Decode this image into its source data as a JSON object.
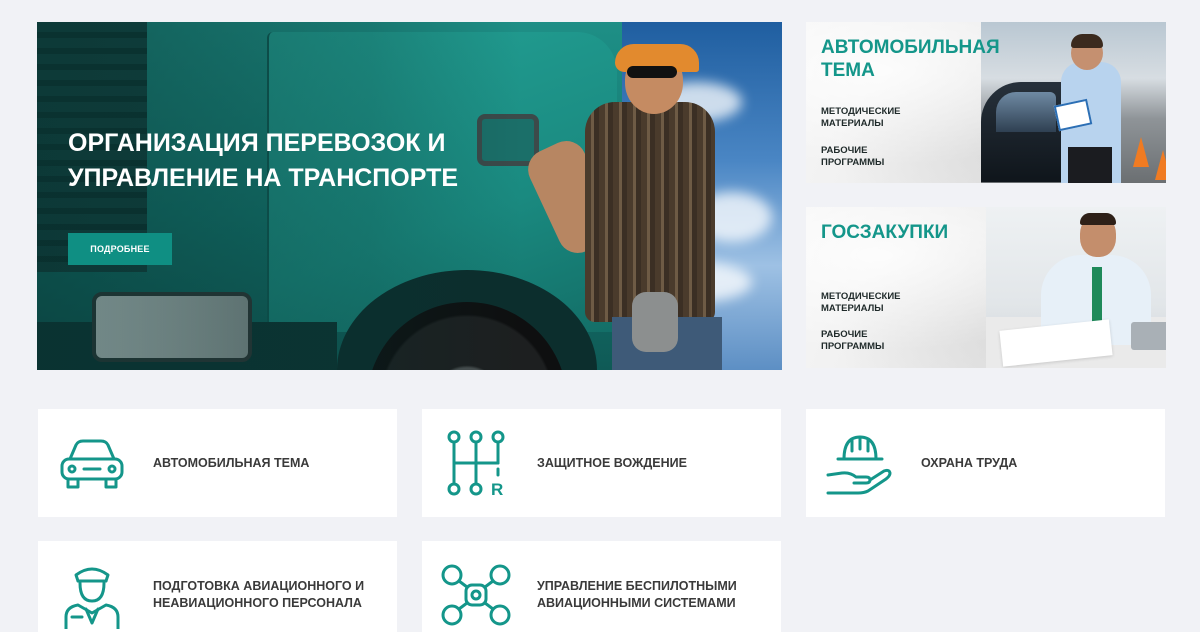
{
  "hero": {
    "title": "Организация перевозок и управление на транспорте",
    "button_label": "ПОДРОБНЕЕ"
  },
  "banners": [
    {
      "title": "Автомобильная тема",
      "links": [
        "Методические материалы",
        "Рабочие программы"
      ]
    },
    {
      "title": "Госзакупки",
      "links": [
        "Методические материалы",
        "Рабочие программы"
      ]
    }
  ],
  "categories": [
    {
      "label": "Автомобильная тема",
      "icon": "car-icon"
    },
    {
      "label": "Защитное вождение",
      "icon": "gearbox-icon"
    },
    {
      "label": "Охрана труда",
      "icon": "hardhat-hand-icon"
    },
    {
      "label": "Подготовка авиационного и неавиационного персонала",
      "icon": "pilot-icon"
    },
    {
      "label": "Управление беспилотными авиационными системами",
      "icon": "drone-icon"
    }
  ],
  "colors": {
    "accent": "#14968a",
    "button": "#0f8f83",
    "background": "#f1f2f6",
    "card": "#ffffff",
    "text": "#3a3a3a"
  }
}
